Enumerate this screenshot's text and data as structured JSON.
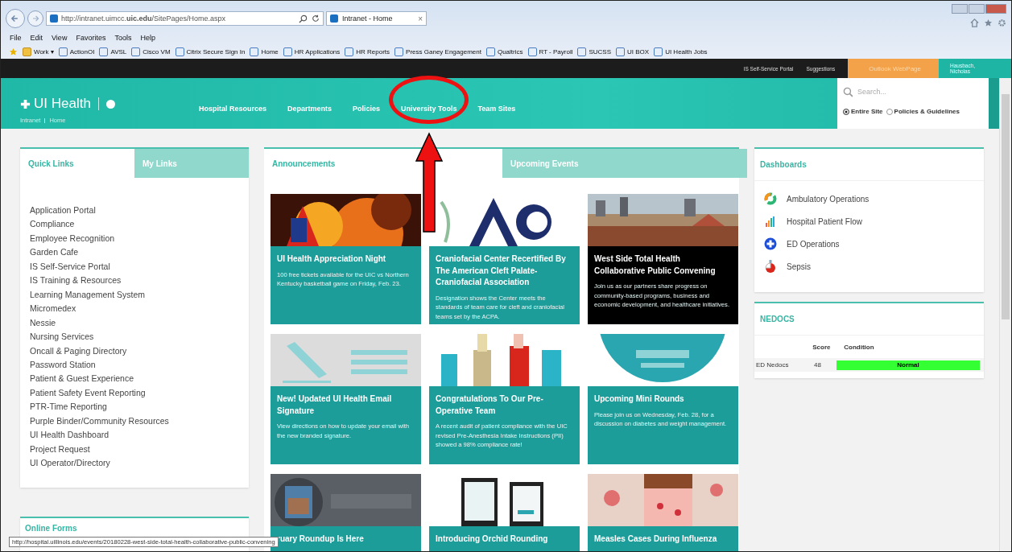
{
  "browser": {
    "address": "http://intranet.uimcc.**uic.edu**/SitePages/Home.aspx",
    "tab": {
      "title": "Intranet - Home",
      "close": "×"
    },
    "menu": [
      "File",
      "Edit",
      "View",
      "Favorites",
      "Tools",
      "Help"
    ],
    "favorites": [
      "Work ▾",
      "ActionOI",
      "AVSL",
      "Cisco VM",
      "Citrix Secure Sign In",
      "Home",
      "HR Applications",
      "HR Reports",
      "Press Ganey Engagement",
      "Qualtrics",
      "RT - Payroll",
      "SUCSS",
      "UI BOX",
      "UI Health Jobs"
    ]
  },
  "top_bar": {
    "links": [
      "IS Self-Service Portal",
      "Suggestions"
    ],
    "outlook": "Outlook WebPage",
    "user": "Hausbach, Nicholas"
  },
  "header": {
    "logo": "UI Health",
    "breadcrumb": [
      "Intranet",
      "Home"
    ],
    "nav": [
      {
        "label": "Hospital Resources",
        "circled": false
      },
      {
        "label": "Departments",
        "circled": false
      },
      {
        "label": "Policies",
        "circled": false
      },
      {
        "label": "University Tools",
        "circled": true
      },
      {
        "label": "Team Sites",
        "circled": false
      }
    ],
    "search": {
      "placeholder": "Search...",
      "scopes": [
        {
          "label": "Entire Site",
          "selected": true
        },
        {
          "label": "Policies & Guidelines",
          "selected": false
        }
      ]
    }
  },
  "quick_links": {
    "tabs": [
      {
        "label": "Quick Links",
        "selected": true
      },
      {
        "label": "My Links",
        "selected": false
      }
    ],
    "links": [
      "Application Portal",
      "Compliance",
      "Employee Recognition",
      "Garden Cafe",
      "IS Self-Service Portal",
      "IS Training & Resources",
      "Learning Management System",
      "Micromedex",
      "Nessie",
      "Nursing Services",
      "Oncall & Paging Directory",
      "Password Station",
      "Patient & Guest Experience",
      "Patient Safety Event Reporting",
      "PTR-Time Reporting",
      "Purple Binder/Community Resources",
      "UI Health Dashboard",
      "Project Request",
      "UI Operator/Directory"
    ]
  },
  "online_forms": {
    "title": "Online Forms"
  },
  "announcements": {
    "tabs": [
      {
        "label": "Announcements",
        "selected": true
      },
      {
        "label": "Upcoming Events",
        "selected": false
      }
    ],
    "cards": [
      {
        "title": "UI Health Appreciation Night",
        "text": "100 free tickets available for the UIC vs Northern Kentucky basketball game on Friday, Feb. 23.",
        "color": "#1d9d9a"
      },
      {
        "title": "Craniofacial Center Recertified By The American Cleft Palate-Craniofacial Association",
        "text": "Designation shows the Center meets the standards of team care for cleft and craniofacial teams set by the ACPA.",
        "color": "#1d9d9a"
      },
      {
        "title": "West Side Total Health Collaborative Public Convening",
        "text": "Join us as our partners share progress on community-based programs, business and economic development, and healthcare initiatives.",
        "color": "#000000"
      },
      {
        "title": "New! Updated UI Health Email Signature",
        "text": "View directions on how to update your email with the new branded signature.",
        "color": "#1d9d9a"
      },
      {
        "title": "Congratulations To Our Pre-Operative Team",
        "text": "A recent audit of patient compliance with the UIC revised Pre-Anesthesia Intake Instructions (PII) showed a 98% compliance rate!",
        "color": "#1d9d9a"
      },
      {
        "title": "Upcoming Mini Rounds",
        "text": "Please join us on Wednesday, Feb. 28, for a discussion on diabetes and weight management.",
        "color": "#1d9d9a"
      },
      {
        "title": "ruary Roundup Is Here",
        "color": "#1d9d9a"
      },
      {
        "title": "Introducing Orchid Rounding",
        "color": "#1d9d9a"
      },
      {
        "title": "Measles Cases During Influenza",
        "color": "#1d9d9a"
      }
    ]
  },
  "dashboards": {
    "title": "Dashboards",
    "items": [
      "Ambulatory Operations",
      "Hospital Patient Flow",
      "ED Operations",
      "Sepsis"
    ]
  },
  "nedocs": {
    "title": "NEDOCS",
    "columns": [
      "Score",
      "Condition"
    ],
    "rows": [
      {
        "name": "ED Nedocs",
        "score": "48",
        "condition": "Normal",
        "color": "#33ff33"
      }
    ]
  },
  "status_tooltip": "http://hospital.uillinois.edu/events/20180228-west-side-total-health-collaborative-public-convening"
}
